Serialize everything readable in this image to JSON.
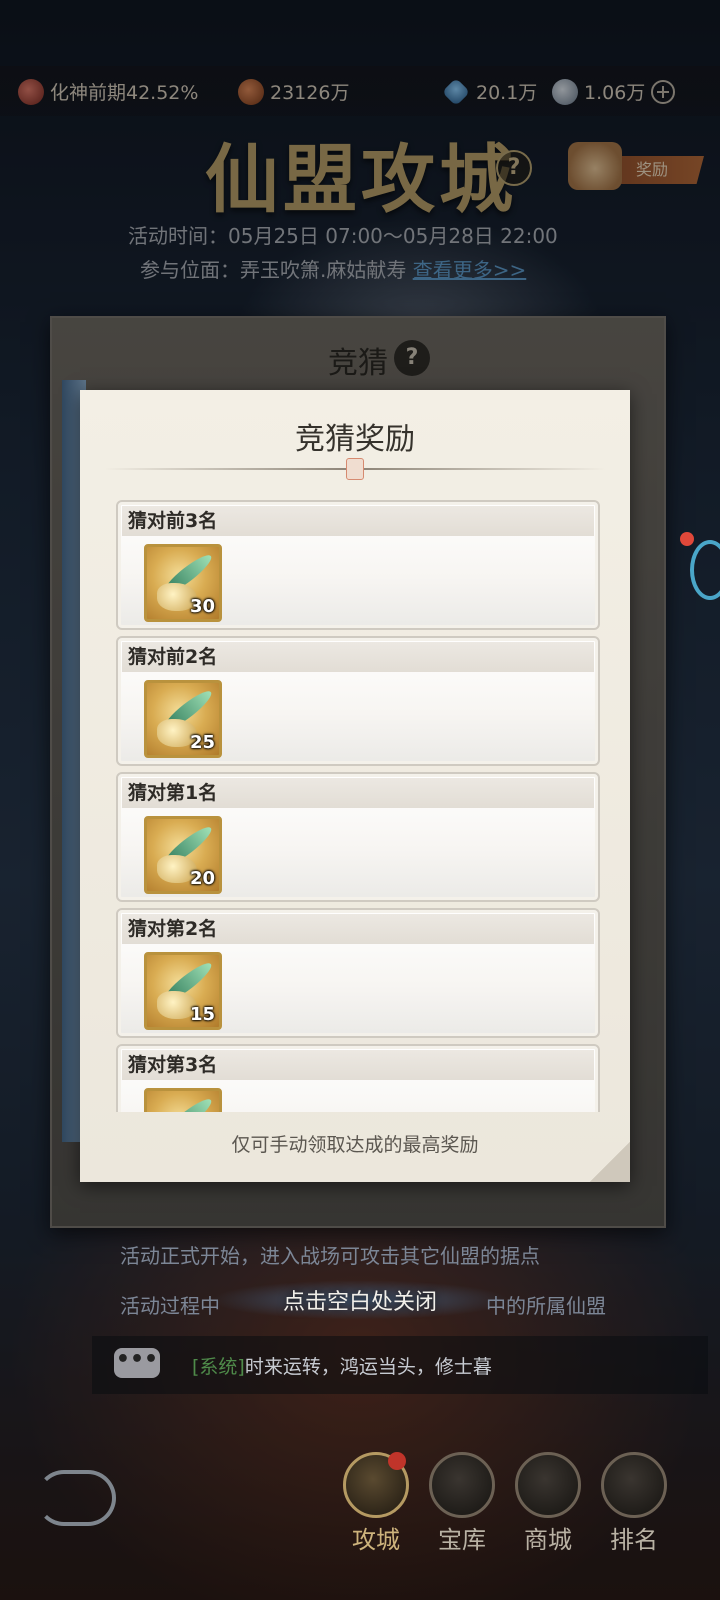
{
  "topbar": {
    "realm": "化神前期42.52%",
    "power": "23126万",
    "spirit_stones": "20.1万",
    "coins": "1.06万"
  },
  "event": {
    "title": "仙盟攻城",
    "reward_tag": "奖励",
    "time": "活动时间：05月25日 07:00～05月28日 22:00",
    "scope_prefix": "参与位面：弄玉吹箫.麻姑献寿 ",
    "scope_more": "查看更多>>"
  },
  "quiz_panel": {
    "title": "竞猜"
  },
  "modal": {
    "title": "竞猜奖励",
    "footer": "仅可手动领取达成的最高奖励",
    "rewards": [
      {
        "label": "猜对前3名",
        "count": "30"
      },
      {
        "label": "猜对前2名",
        "count": "25"
      },
      {
        "label": "猜对第1名",
        "count": "20"
      },
      {
        "label": "猜对第2名",
        "count": "15"
      },
      {
        "label": "猜对第3名",
        "count": ""
      }
    ]
  },
  "info": {
    "line1": "活动正式开始，进入战场可攻击其它仙盟的据点",
    "line2": "活动过程中",
    "line2_tail": "中的所属仙盟",
    "close_hint": "点击空白处关闭"
  },
  "chat": {
    "icon": "•••",
    "system_tag": "[系统]",
    "message": "时来运转，鸿运当头，修士暮"
  },
  "nav": {
    "items": [
      {
        "label": "攻城"
      },
      {
        "label": "宝库"
      },
      {
        "label": "商城"
      },
      {
        "label": "排名"
      }
    ]
  },
  "icons": {
    "realm": "realm-icon",
    "power": "battle-power-icon",
    "spirit": "spirit-stone-icon",
    "coin": "coin-icon",
    "add": "plus-icon",
    "help": "question-icon",
    "gift": "gift-icon",
    "chat": "chat-bubble-icon",
    "reward_item": "herb-gold-icon"
  },
  "colors": {
    "accent_gold": "#b8a06a",
    "link_blue": "#5e9ccc",
    "system_green": "#4f8b4a",
    "badge_red": "#c0342a"
  }
}
